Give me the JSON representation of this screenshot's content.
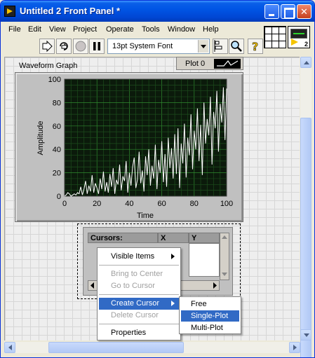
{
  "window": {
    "title": "Untitled 2 Front Panel *"
  },
  "menubar": {
    "items": [
      "File",
      "Edit",
      "View",
      "Project",
      "Operate",
      "Tools",
      "Window",
      "Help"
    ]
  },
  "toolbar": {
    "font_select_value": "13pt System Font",
    "vi_icon_number": "2"
  },
  "graph": {
    "label": "Waveform Graph",
    "plot_legend_label": "Plot 0",
    "ylabel": "Amplitude",
    "xlabel": "Time",
    "yticks": [
      "100",
      "80",
      "60",
      "40",
      "20",
      "0"
    ],
    "xticks": [
      "0",
      "20",
      "40",
      "60",
      "80",
      "100"
    ]
  },
  "chart_data": {
    "type": "line",
    "xlim": [
      0,
      100
    ],
    "ylim": [
      0,
      100
    ],
    "xlabel": "Time",
    "ylabel": "Amplitude",
    "grid": true,
    "x": [
      0,
      1,
      2,
      3,
      4,
      5,
      6,
      7,
      8,
      9,
      10,
      11,
      12,
      13,
      14,
      15,
      16,
      17,
      18,
      19,
      20,
      21,
      22,
      23,
      24,
      25,
      26,
      27,
      28,
      29,
      30,
      31,
      32,
      33,
      34,
      35,
      36,
      37,
      38,
      39,
      40,
      41,
      42,
      43,
      44,
      45,
      46,
      47,
      48,
      49,
      50,
      51,
      52,
      53,
      54,
      55,
      56,
      57,
      58,
      59,
      60,
      61,
      62,
      63,
      64,
      65,
      66,
      67,
      68,
      69,
      70,
      71,
      72,
      73,
      74,
      75,
      76,
      77,
      78,
      79,
      80,
      81,
      82,
      83,
      84,
      85,
      86,
      87,
      88,
      89,
      90,
      91,
      92,
      93,
      94,
      95,
      96,
      97,
      98,
      99,
      100
    ],
    "values": [
      0,
      1,
      3,
      2,
      0,
      1,
      2,
      1,
      3,
      2,
      8,
      1,
      6,
      13,
      2,
      9,
      4,
      18,
      3,
      11,
      7,
      2,
      15,
      6,
      21,
      4,
      12,
      3,
      19,
      8,
      24,
      2,
      14,
      10,
      27,
      5,
      17,
      13,
      30,
      3,
      20,
      9,
      25,
      33,
      7,
      14,
      38,
      11,
      22,
      4,
      34,
      18,
      40,
      9,
      26,
      15,
      44,
      6,
      31,
      20,
      47,
      12,
      36,
      8,
      50,
      24,
      41,
      15,
      53,
      19,
      58,
      7,
      45,
      28,
      62,
      16,
      50,
      35,
      70,
      23,
      56,
      40,
      75,
      30,
      61,
      18,
      80,
      45,
      66,
      52,
      85,
      27,
      72,
      58,
      90,
      38,
      79,
      63,
      93,
      48,
      92
    ]
  },
  "cursor_legend": {
    "header_cursors": "Cursors:",
    "header_x": "X",
    "header_y": "Y"
  },
  "context_menu": {
    "visible_items": "Visible Items",
    "bring_to_center": "Bring to Center",
    "go_to_cursor": "Go to Cursor",
    "create_cursor": "Create Cursor",
    "delete_cursor": "Delete Cursor",
    "properties": "Properties"
  },
  "create_cursor_submenu": {
    "free": "Free",
    "single_plot": "Single-Plot",
    "multi_plot": "Multi-Plot"
  }
}
